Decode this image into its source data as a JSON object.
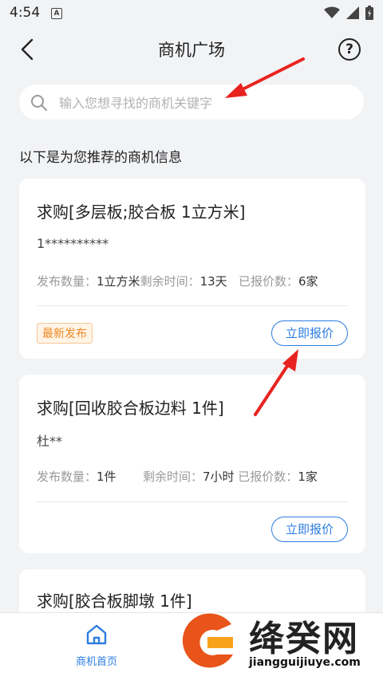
{
  "status_bar": {
    "time": "4:54",
    "a_icon": "A"
  },
  "nav": {
    "title": "商机广场",
    "help_symbol": "?"
  },
  "search": {
    "placeholder": "输入您想寻找的商机关键字",
    "value": ""
  },
  "section_title": "以下是为您推荐的商机信息",
  "cards": [
    {
      "title": "求购[多层板;胶合板 1立方米]",
      "user": "1**********",
      "qty_label": "发布数量：",
      "qty": "1立方米",
      "time_label": "剩余时间：",
      "time": "13天",
      "quotes_label": "已报价数：",
      "quotes": "6家",
      "badge": "最新发布",
      "button": "立即报价"
    },
    {
      "title": "求购[回收胶合板边料 1件]",
      "user": "杜**",
      "qty_label": "发布数量：",
      "qty": "1件",
      "time_label": "剩余时间：",
      "time": "7小时",
      "quotes_label": "已报价数：",
      "quotes": "1家",
      "button": "立即报价"
    },
    {
      "title": "求购[胶合板脚墩 1件]"
    }
  ],
  "tab_bar": {
    "home_label": "商机首页"
  },
  "watermark": {
    "text": "绛癸网",
    "url": "jiangguijiuye.com"
  },
  "colors": {
    "accent": "#2d7de0",
    "badge": "#f08a24",
    "arrow": "#e8231f"
  }
}
